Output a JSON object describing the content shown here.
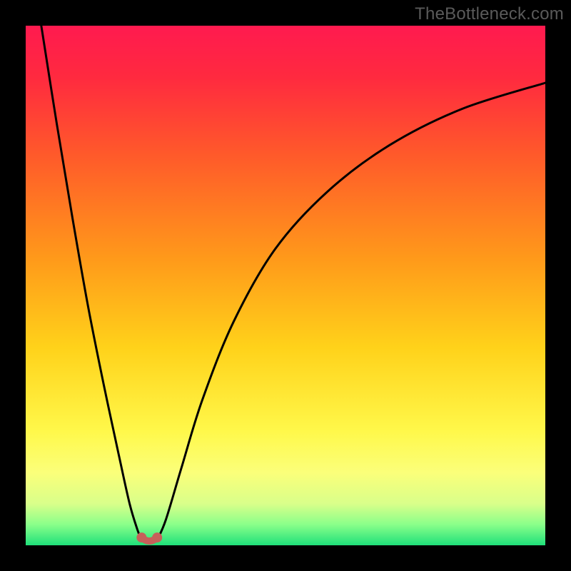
{
  "watermark": "TheBottleneck.com",
  "colors": {
    "background_black": "#000000",
    "curve_stroke": "#000000",
    "marker_fill": "#c6605a",
    "gradient_stops": [
      {
        "offset": 0.0,
        "color": "#ff1a4f"
      },
      {
        "offset": 0.1,
        "color": "#ff2a3f"
      },
      {
        "offset": 0.25,
        "color": "#ff5a2a"
      },
      {
        "offset": 0.45,
        "color": "#ff9a1a"
      },
      {
        "offset": 0.62,
        "color": "#ffd21a"
      },
      {
        "offset": 0.78,
        "color": "#fff84a"
      },
      {
        "offset": 0.86,
        "color": "#fbff7a"
      },
      {
        "offset": 0.92,
        "color": "#d9ff8a"
      },
      {
        "offset": 0.96,
        "color": "#8aff8a"
      },
      {
        "offset": 1.0,
        "color": "#1fe07a"
      }
    ]
  },
  "chart_data": {
    "type": "line",
    "title": "",
    "xlabel": "",
    "ylabel": "",
    "xlim": [
      0,
      100
    ],
    "ylim": [
      0,
      100
    ],
    "note": "Axes are unlabeled in the image; 0–100 is an approximate normalized percentage scale. y represents a bottleneck-like metric where low is good (green) and high is bad (red). Values read from pixel positions.",
    "series": [
      {
        "name": "left-branch",
        "x": [
          3,
          6,
          9,
          12,
          15,
          18,
          20,
          21.5,
          22.3
        ],
        "y": [
          100,
          81,
          63,
          46,
          31,
          17,
          8,
          3,
          1
        ]
      },
      {
        "name": "right-branch",
        "x": [
          25.3,
          27,
          30,
          34,
          40,
          48,
          58,
          70,
          84,
          100
        ],
        "y": [
          1,
          5,
          15,
          28,
          43,
          57,
          68,
          77,
          84,
          89
        ]
      }
    ],
    "min_markers": {
      "name": "minimum-cluster",
      "points": [
        {
          "x": 22.3,
          "y": 1.5
        },
        {
          "x": 25.3,
          "y": 1.5
        }
      ]
    }
  }
}
